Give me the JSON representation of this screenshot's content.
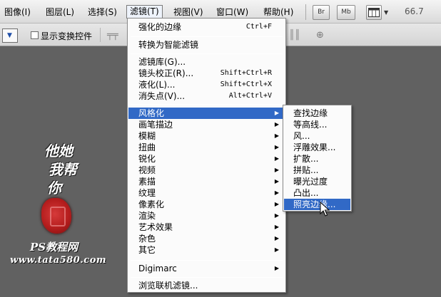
{
  "menubar": {
    "items": [
      {
        "label": "图像(I)"
      },
      {
        "label": "图层(L)"
      },
      {
        "label": "选择(S)"
      },
      {
        "label": "滤镜(T)"
      },
      {
        "label": "视图(V)"
      },
      {
        "label": "窗口(W)"
      },
      {
        "label": "帮助(H)"
      }
    ],
    "bridge_label": "Br",
    "minibridge_label": "Mb",
    "zoom": "66.7"
  },
  "options": {
    "show_transform_controls": "显示变换控件",
    "show_transform_checked": false
  },
  "filter_menu": {
    "last_filter": {
      "label": "强化的边缘",
      "shortcut": "Ctrl+F"
    },
    "convert_smart": {
      "label": "转换为智能滤镜"
    },
    "filter_gallery": {
      "label": "滤镜库(G)..."
    },
    "lens_correction": {
      "label": "镜头校正(R)...",
      "shortcut": "Shift+Ctrl+R"
    },
    "liquify": {
      "label": "液化(L)...",
      "shortcut": "Shift+Ctrl+X"
    },
    "vanishing_point": {
      "label": "消失点(V)...",
      "shortcut": "Alt+Ctrl+V"
    },
    "categories": [
      {
        "label": "风格化"
      },
      {
        "label": "画笔描边"
      },
      {
        "label": "模糊"
      },
      {
        "label": "扭曲"
      },
      {
        "label": "锐化"
      },
      {
        "label": "视频"
      },
      {
        "label": "素描"
      },
      {
        "label": "纹理"
      },
      {
        "label": "像素化"
      },
      {
        "label": "渲染"
      },
      {
        "label": "艺术效果"
      },
      {
        "label": "杂色"
      },
      {
        "label": "其它"
      }
    ],
    "digimarc": {
      "label": "Digimarc"
    },
    "browse_online": {
      "label": "浏览联机滤镜..."
    }
  },
  "stylize_submenu": {
    "items": [
      {
        "label": "查找边缘"
      },
      {
        "label": "等高线..."
      },
      {
        "label": "风..."
      },
      {
        "label": "浮雕效果..."
      },
      {
        "label": "扩散..."
      },
      {
        "label": "拼贴..."
      },
      {
        "label": "曝光过度"
      },
      {
        "label": "凸出..."
      },
      {
        "label": "照亮边缘..."
      }
    ],
    "highlighted_index": 8
  },
  "watermark": {
    "line1": "他她",
    "line2": "我帮",
    "line3": "你",
    "ps_logo": "PS教程网",
    "url": "www.tata580.com"
  },
  "colors": {
    "highlight": "#3169c6",
    "workspace": "#616161",
    "seal": "#b41d1d"
  }
}
